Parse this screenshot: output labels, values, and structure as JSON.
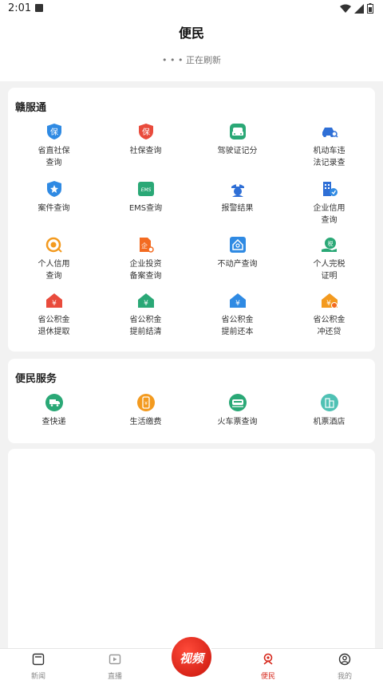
{
  "status": {
    "time": "2:01"
  },
  "header": {
    "title": "便民",
    "refresh": "• • • 正在刷新"
  },
  "section1": {
    "title": "赣服通",
    "items": [
      {
        "label": "省直社保\n查询",
        "icon": "shield-bao-icon"
      },
      {
        "label": "社保查询",
        "icon": "shield-bao-red-icon"
      },
      {
        "label": "驾驶证记分",
        "icon": "car-front-icon"
      },
      {
        "label": "机动车违\n法记录查",
        "icon": "car-search-icon"
      },
      {
        "label": "案件查询",
        "icon": "badge-star-icon"
      },
      {
        "label": "EMS查询",
        "icon": "ems-icon"
      },
      {
        "label": "报警结果",
        "icon": "police-icon"
      },
      {
        "label": "企业信用\n查询",
        "icon": "building-icon"
      },
      {
        "label": "个人信用\n查询",
        "icon": "credit-icon"
      },
      {
        "label": "企业投资\n备案查询",
        "icon": "invest-icon"
      },
      {
        "label": "不动产查询",
        "icon": "house-search-icon"
      },
      {
        "label": "个人完税\n证明",
        "icon": "tax-icon"
      },
      {
        "label": "省公积金\n退休提取",
        "icon": "fund-red-icon"
      },
      {
        "label": "省公积金\n提前结清",
        "icon": "fund-green-icon"
      },
      {
        "label": "省公积金\n提前还本",
        "icon": "fund-blue-icon"
      },
      {
        "label": "省公积金\n冲还贷",
        "icon": "fund-orange-icon"
      }
    ]
  },
  "section2": {
    "title": "便民服务",
    "items": [
      {
        "label": "查快递",
        "icon": "truck-icon"
      },
      {
        "label": "生活缴费",
        "icon": "phone-bill-icon"
      },
      {
        "label": "火车票查询",
        "icon": "train-icon"
      },
      {
        "label": "机票酒店",
        "icon": "hotel-icon"
      }
    ]
  },
  "tabs": [
    {
      "label": "新闻",
      "icon": "news-icon"
    },
    {
      "label": "直播",
      "icon": "live-icon"
    },
    {
      "label": "视频",
      "icon": "video-icon"
    },
    {
      "label": "便民",
      "icon": "service-icon",
      "active": true
    },
    {
      "label": "我的",
      "icon": "profile-icon"
    }
  ],
  "colors": {
    "accent": "#d6281c",
    "blue": "#2f8ae3",
    "green": "#2aa876",
    "orange": "#f39a1f",
    "red": "#e94b3c"
  }
}
